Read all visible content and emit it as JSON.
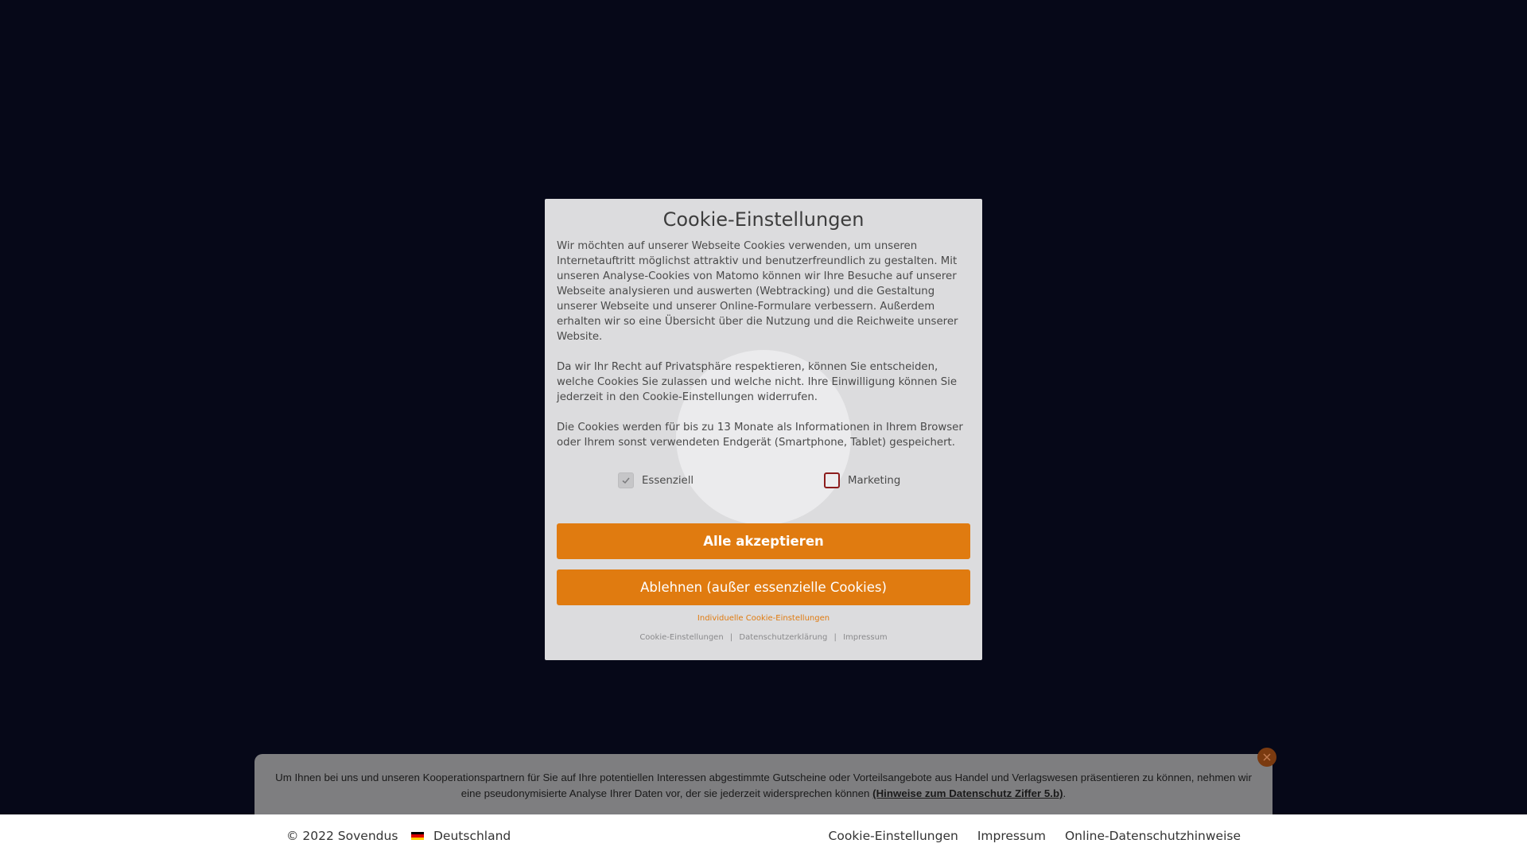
{
  "modal": {
    "title": "Cookie-Einstellungen",
    "paragraphs": [
      "Wir möchten auf unserer Webseite Cookies verwenden, um unseren Internetauftritt möglichst attraktiv und benutzerfreundlich zu gestalten. Mit unseren Analyse-Cookies von Matomo können wir Ihre Besuche auf unserer Webseite analysieren und auswerten (Webtracking) und die Gestaltung unserer Webseite und unserer Online-Formulare verbessern. Außerdem erhalten wir so eine Übersicht über die Nutzung und die Reichweite unserer Website.",
      "Da wir Ihr Recht auf Privatsphäre respektieren, können Sie entscheiden, welche Cookies Sie zulassen und welche nicht. Ihre Einwilligung können Sie jederzeit in den Cookie-Einstellungen widerrufen.",
      "Die Cookies werden für bis zu 13 Monate als Informationen in Ihrem Browser oder Ihrem sonst verwendeten Endgerät (Smartphone, Tablet) gespeichert."
    ],
    "checkboxes": {
      "essential": {
        "label": "Essenziell",
        "checked": true,
        "disabled": true
      },
      "marketing": {
        "label": "Marketing",
        "checked": false
      }
    },
    "accept_all_label": "Alle akzeptieren",
    "reject_label": "Ablehnen (außer essenzielle Cookies)",
    "individual_label": "Individuelle Cookie-Einstellungen",
    "footer_links": {
      "cookie_settings": "Cookie-Einstellungen",
      "privacy": "Datenschutzerklärung",
      "imprint": "Impressum",
      "separator": "|"
    },
    "accent_color": "#e07b10"
  },
  "info_banner": {
    "text": "Um Ihnen bei uns und unseren Kooperationspartnern für Sie auf Ihre potentiellen Interessen abgestimmte Gutscheine oder Vorteilsangebote aus Handel und Verlagswesen präsentieren zu können, nehmen wir eine pseudonymisierte Analyse Ihrer Daten vor, der sie jederzeit widersprechen können ",
    "link_label": "(Hinweise zum Datenschutz Ziffer 5.b)",
    "text_end": ".",
    "close_icon": "close-icon"
  },
  "footer": {
    "copyright": "© 2022 Sovendus",
    "country": "Deutschland",
    "links": {
      "cookie_settings": "Cookie-Einstellungen",
      "imprint": "Impressum",
      "privacy": "Online-Datenschutzhinweise"
    }
  }
}
